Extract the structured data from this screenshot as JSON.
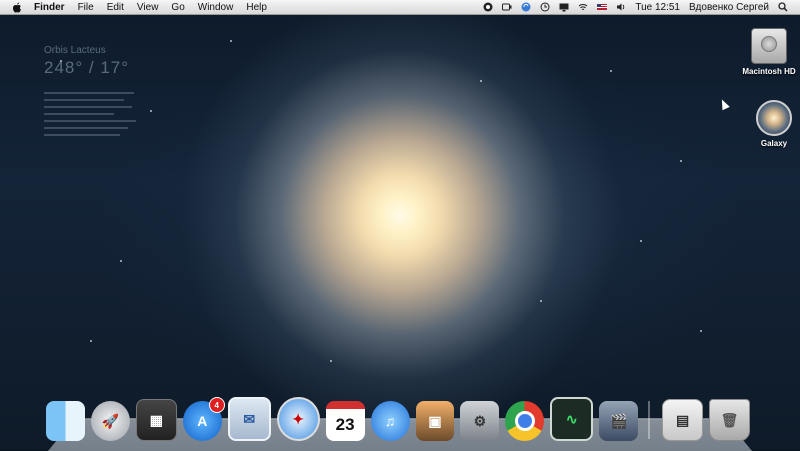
{
  "menubar": {
    "app_menu": "Finder",
    "menus": [
      "File",
      "Edit",
      "View",
      "Go",
      "Window",
      "Help"
    ],
    "status_icons": [
      "record-icon",
      "camera-icon",
      "sync-icon",
      "clock-icon",
      "display-icon",
      "wifi-icon",
      "flag-icon",
      "volume-icon"
    ],
    "clock": "Tue 12:51",
    "user": "Вдовенко Сергей",
    "search_icon": "spotlight-icon"
  },
  "wallpaper_overlay": {
    "title": "Orbis Lacteus",
    "coords": "248° / 17°"
  },
  "desktop_icons": [
    {
      "name": "macintosh-hd",
      "label": "Macintosh HD"
    },
    {
      "name": "galaxy",
      "label": "Galaxy"
    }
  ],
  "dock": {
    "items": [
      {
        "name": "finder",
        "icon": "finder-icon",
        "glyph": ""
      },
      {
        "name": "launchpad",
        "icon": "rocket-icon",
        "glyph": "🚀"
      },
      {
        "name": "mission-control",
        "icon": "mission-control-icon",
        "glyph": "▦"
      },
      {
        "name": "app-store",
        "icon": "app-store-icon",
        "glyph": "A",
        "badge": "4"
      },
      {
        "name": "mail",
        "icon": "mail-icon",
        "glyph": "✉"
      },
      {
        "name": "safari",
        "icon": "compass-icon",
        "glyph": "✦"
      },
      {
        "name": "ical",
        "icon": "calendar-icon",
        "glyph": "23"
      },
      {
        "name": "itunes",
        "icon": "music-icon",
        "glyph": "♫"
      },
      {
        "name": "iphoto",
        "icon": "photo-icon",
        "glyph": "▣"
      },
      {
        "name": "system-preferences",
        "icon": "gear-icon",
        "glyph": "⚙"
      },
      {
        "name": "chrome",
        "icon": "chrome-icon",
        "glyph": ""
      },
      {
        "name": "activity-monitor",
        "icon": "activity-monitor-icon",
        "glyph": "∿"
      },
      {
        "name": "imovie",
        "icon": "film-icon",
        "glyph": "🎬"
      }
    ],
    "right_items": [
      {
        "name": "documents-stack",
        "icon": "documents-icon",
        "glyph": "▤"
      },
      {
        "name": "trash",
        "icon": "trash-icon",
        "glyph": "🗑"
      }
    ]
  }
}
